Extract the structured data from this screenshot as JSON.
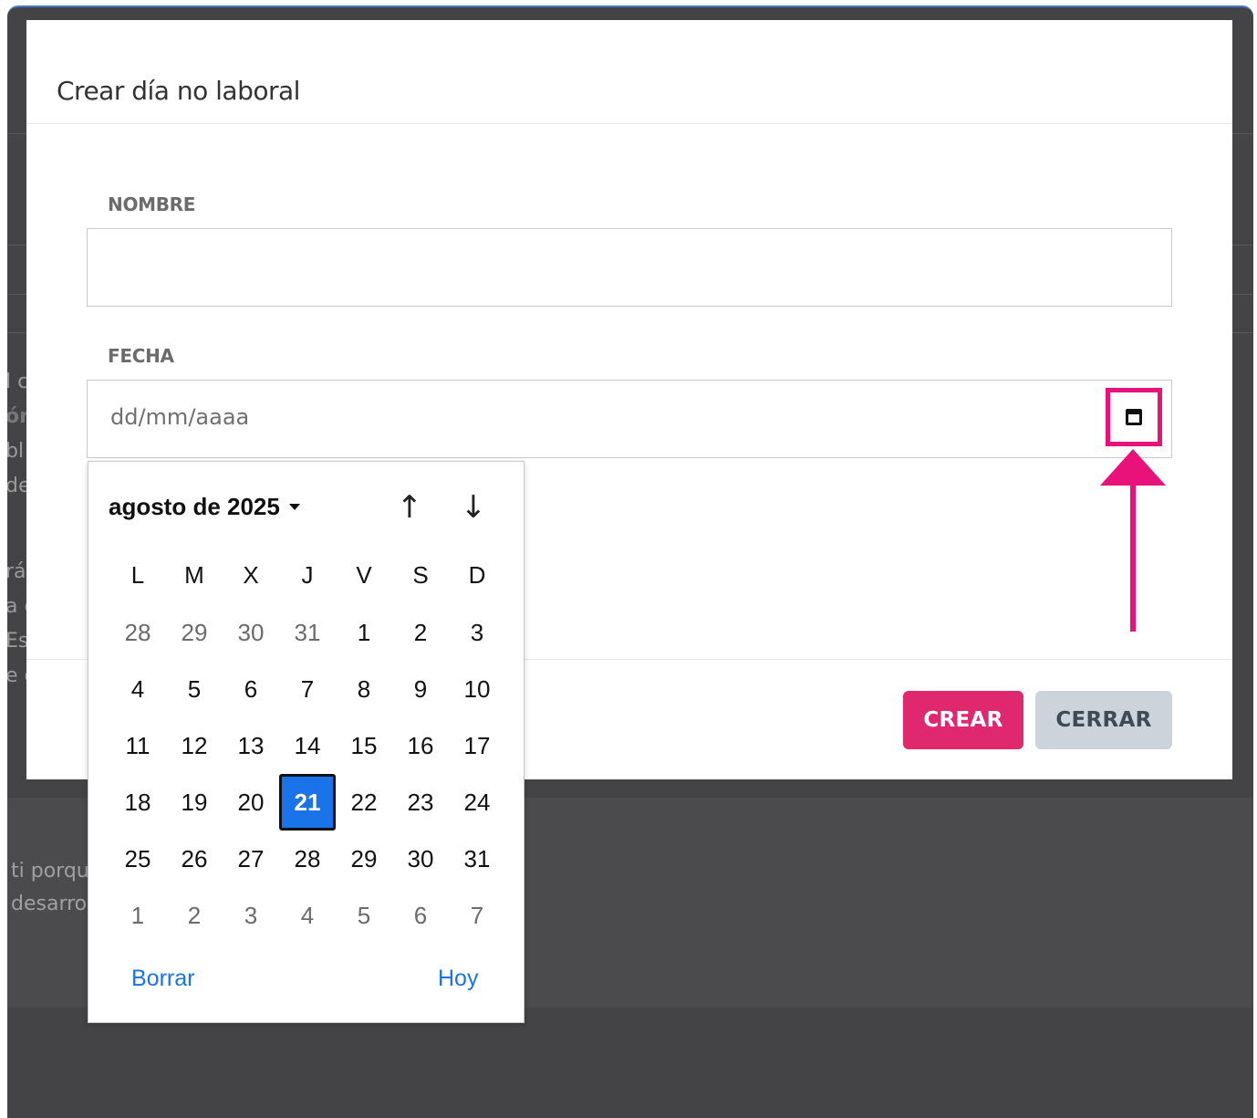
{
  "modal": {
    "title": "Crear día no laboral",
    "nombre_label": "NOMBRE",
    "nombre_value": "",
    "fecha_label": "FECHA",
    "fecha_placeholder": "dd/mm/aaaa",
    "calendar_icon": "calendar-icon",
    "create_label": "CREAR",
    "close_label": "CERRAR"
  },
  "colors": {
    "primary": "#e0286f",
    "annotation": "#e8127a",
    "selected_day": "#1a73e8",
    "secondary_button": "#cdd3db"
  },
  "datepicker": {
    "month_label": "agosto de 2025",
    "prev_icon": "arrow-up-icon",
    "next_icon": "arrow-down-icon",
    "weekdays": [
      "L",
      "M",
      "X",
      "J",
      "V",
      "S",
      "D"
    ],
    "weeks": [
      [
        "28",
        "29",
        "30",
        "31",
        "1",
        "2",
        "3"
      ],
      [
        "4",
        "5",
        "6",
        "7",
        "8",
        "9",
        "10"
      ],
      [
        "11",
        "12",
        "13",
        "14",
        "15",
        "16",
        "17"
      ],
      [
        "18",
        "19",
        "20",
        "21",
        "22",
        "23",
        "24"
      ],
      [
        "25",
        "26",
        "27",
        "28",
        "29",
        "30",
        "31"
      ],
      [
        "1",
        "2",
        "3",
        "4",
        "5",
        "6",
        "7"
      ]
    ],
    "selected_day": "21",
    "clear_label": "Borrar",
    "today_label": "Hoy"
  },
  "background": {
    "fragments": [
      "l c",
      "ór",
      "bl",
      "de",
      "rá",
      "a c",
      "Es",
      "e c",
      "ti porqu",
      "desarro"
    ]
  }
}
